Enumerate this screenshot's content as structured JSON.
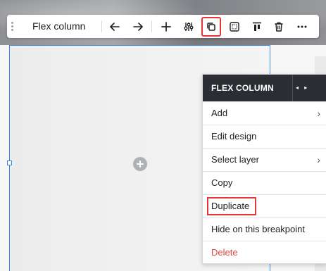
{
  "toolbar": {
    "title": "Flex column",
    "buttons": [
      {
        "name": "back-arrow-icon",
        "glyph": "arrow-left"
      },
      {
        "name": "forward-arrow-icon",
        "glyph": "arrow-right"
      },
      {
        "name": "add-icon",
        "glyph": "plus"
      },
      {
        "name": "adjust-settings-icon",
        "glyph": "sliders"
      },
      {
        "name": "duplicate-icon",
        "glyph": "duplicate",
        "highlighted": true
      },
      {
        "name": "select-frame-icon",
        "glyph": "frame"
      },
      {
        "name": "align-top-icon",
        "glyph": "align-top"
      },
      {
        "name": "delete-trash-icon",
        "glyph": "trash"
      },
      {
        "name": "more-options-icon",
        "glyph": "dots"
      }
    ]
  },
  "context_menu": {
    "title": "FLEX COLUMN",
    "arrows": "◂ ▸",
    "items": [
      {
        "label": "Add",
        "has_submenu": true,
        "style": "normal"
      },
      {
        "label": "Edit design",
        "has_submenu": false,
        "style": "normal"
      },
      {
        "label": "Select layer",
        "has_submenu": true,
        "style": "normal"
      },
      {
        "label": "Copy",
        "has_submenu": false,
        "style": "normal"
      },
      {
        "label": "Duplicate",
        "has_submenu": false,
        "style": "normal",
        "highlighted": true
      },
      {
        "label": "Hide on this breakpoint",
        "has_submenu": false,
        "style": "normal"
      },
      {
        "label": "Delete",
        "has_submenu": false,
        "style": "danger"
      }
    ],
    "submenu_chevron": "›"
  },
  "colors": {
    "selection_blue": "#3b88f5",
    "highlight_red": "#e53935",
    "menu_header": "#2a2e33",
    "delete_red": "#e0483d"
  }
}
